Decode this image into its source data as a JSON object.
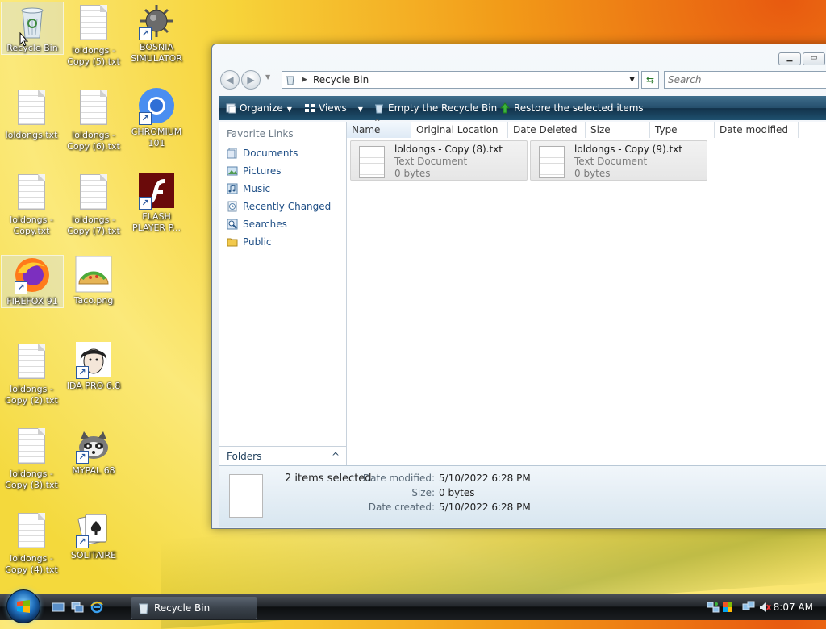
{
  "desktop": {
    "icons": [
      {
        "label": "Recycle Bin",
        "type": "bin"
      },
      {
        "label": "loldongs - Copy (5).txt",
        "type": "doc"
      },
      {
        "label": "BOSNIA SIMULATOR",
        "type": "mine"
      },
      {
        "label": "loldongs.txt",
        "type": "doc"
      },
      {
        "label": "loldongs - Copy (6).txt",
        "type": "doc"
      },
      {
        "label": "CHROMIUM 101",
        "type": "chromium"
      },
      {
        "label": "loldongs - Copy.txt",
        "type": "doc"
      },
      {
        "label": "loldongs - Copy (7).txt",
        "type": "doc"
      },
      {
        "label": "FLASH PLAYER P...",
        "type": "flash"
      },
      {
        "label": "FIREFOX 91",
        "type": "firefox"
      },
      {
        "label": "Taco.png",
        "type": "taco"
      },
      {
        "label": "loldongs - Copy (2).txt",
        "type": "doc"
      },
      {
        "label": "IDA PRO 6.8",
        "type": "ida"
      },
      {
        "label": "loldongs - Copy (3).txt",
        "type": "doc"
      },
      {
        "label": "MYPAL 68",
        "type": "mypal"
      },
      {
        "label": "loldongs - Copy (4).txt",
        "type": "doc"
      },
      {
        "label": "SOLITAIRE",
        "type": "solitaire"
      }
    ]
  },
  "window": {
    "address": {
      "crumb": "Recycle Bin"
    },
    "search": {
      "placeholder": "Search"
    },
    "toolbar": {
      "organize": "Organize",
      "views": "Views",
      "empty": "Empty the Recycle Bin",
      "restore": "Restore the selected items"
    },
    "nav": {
      "heading": "Favorite Links",
      "items": [
        "Documents",
        "Pictures",
        "Music",
        "Recently Changed",
        "Searches",
        "Public"
      ],
      "folders": "Folders"
    },
    "columns": [
      "Name",
      "Original Location",
      "Date Deleted",
      "Size",
      "Type",
      "Date modified"
    ],
    "files": [
      {
        "name": "loldongs - Copy (8).txt",
        "type": "Text Document",
        "size": "0 bytes"
      },
      {
        "name": "loldongs - Copy (9).txt",
        "type": "Text Document",
        "size": "0 bytes"
      }
    ],
    "details": {
      "count": "2 items selected",
      "modified_label": "Date modified:",
      "modified_value": "5/10/2022 6:28 PM",
      "size_label": "Size:",
      "size_value": "0 bytes",
      "created_label": "Date created:",
      "created_value": "5/10/2022 6:28 PM"
    }
  },
  "taskbar": {
    "task_label": "Recycle Bin",
    "clock": "8:07 AM"
  },
  "colors": {
    "toolbar": "#254f6c",
    "link": "#1f4f86"
  }
}
